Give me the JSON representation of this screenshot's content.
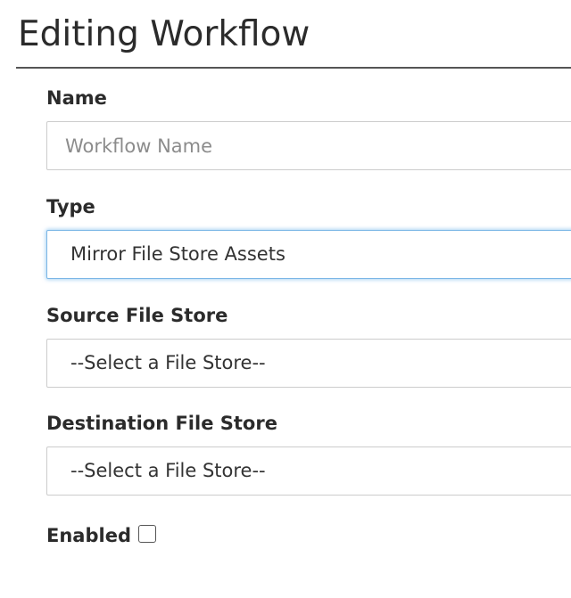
{
  "page": {
    "title": "Editing Workflow"
  },
  "form": {
    "name": {
      "label": "Name",
      "value": "",
      "placeholder": "Workflow Name"
    },
    "type": {
      "label": "Type",
      "selected": "Mirror File Store Assets"
    },
    "source_file_store": {
      "label": "Source File Store",
      "selected": "--Select a File Store--"
    },
    "destination_file_store": {
      "label": "Destination File Store",
      "selected": "--Select a File Store--"
    },
    "enabled": {
      "label": "Enabled",
      "checked": false
    }
  },
  "colors": {
    "focus_border": "#7bb6e6",
    "input_border": "#cccccc",
    "rule": "#555555"
  }
}
